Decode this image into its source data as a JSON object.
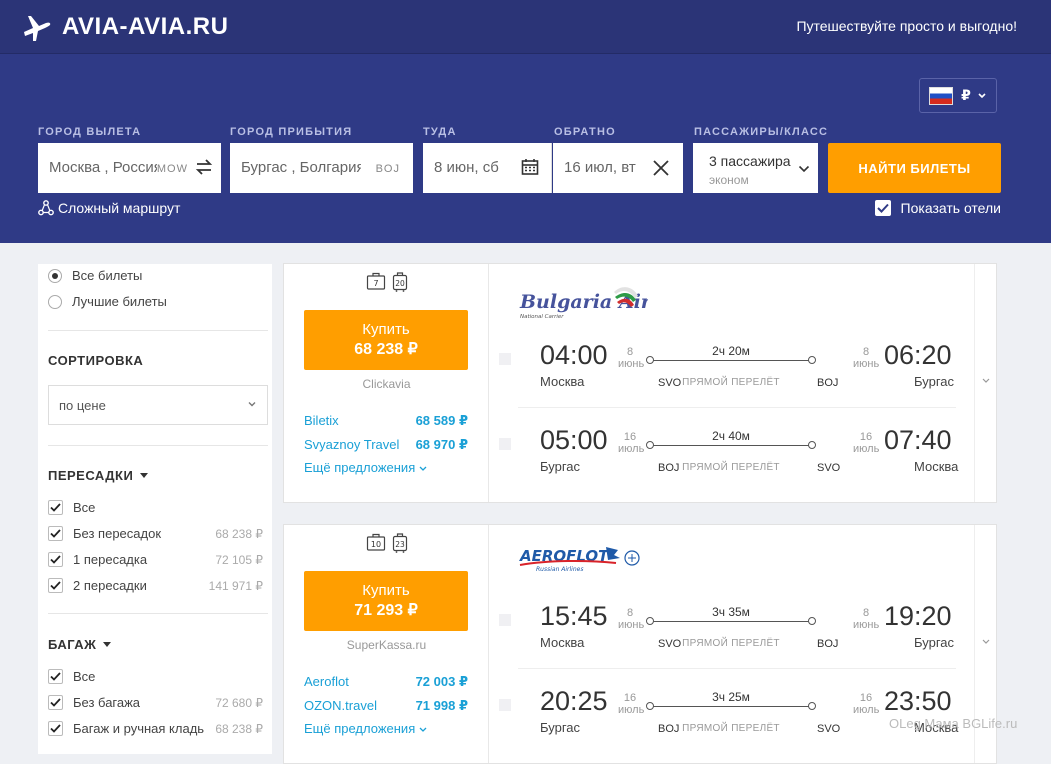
{
  "header": {
    "brand": "AVIA-AVIA.RU",
    "tagline": "Путешествуйте просто и выгодно!"
  },
  "currency": "₽",
  "search": {
    "from_label": "ГОРОД ВЫЛЕТА",
    "from_value": "Москва , Россия",
    "from_code": "MOW",
    "to_label": "ГОРОД ПРИБЫТИЯ",
    "to_value": "Бургас , Болгария",
    "to_code": "BOJ",
    "depart_label": "ТУДА",
    "depart_value": "8 июн, сб",
    "return_label": "ОБРАТНО",
    "return_value": "16 июл, вт",
    "pax_label": "ПАССАЖИРЫ/КЛАСС",
    "pax_value": "3 пассажира",
    "class_value": "эконом",
    "search_button": "НАЙТИ БИЛЕТЫ",
    "complex_route": "Сложный маршрут",
    "show_hotels": "Показать отели"
  },
  "filters": {
    "all_tickets": "Все билеты",
    "best_tickets": "Лучшие билеты",
    "sort_title": "СОРТИРОВКА",
    "sort_value": "по цене",
    "transfers_title": "ПЕРЕСАДКИ",
    "transfers": [
      {
        "label": "Все",
        "value": ""
      },
      {
        "label": "Без пересадок",
        "value": "68 238 ₽"
      },
      {
        "label": "1 пересадка",
        "value": "72 105 ₽"
      },
      {
        "label": "2 пересадки",
        "value": "141 971 ₽"
      }
    ],
    "baggage_title": "БАГАЖ",
    "baggage": [
      {
        "label": "Все",
        "value": ""
      },
      {
        "label": "Без багажа",
        "value": "72 680 ₽"
      },
      {
        "label": "Багаж и ручная кладь",
        "value": "68 238 ₽"
      }
    ]
  },
  "results": [
    {
      "airline": "Bulgaria Air",
      "airline_sub": "National Carrier",
      "bag1": "7",
      "bag2": "20",
      "buy_label": "Купить",
      "price": "68 238 ₽",
      "agent": "Clickavia",
      "offers": [
        {
          "name": "Biletix",
          "price": "68 589 ₽"
        },
        {
          "name": "Svyaznoy Travel",
          "price": "68 970 ₽"
        }
      ],
      "more": "Ещё предложения",
      "legs": [
        {
          "dep_time": "04:00",
          "dep_day": "8",
          "dep_month": "июнь",
          "dep_city": "Москва",
          "dep_ap": "SVO",
          "duration": "2ч 20м",
          "direct": "ПРЯМОЙ ПЕРЕЛЁТ",
          "arr_ap": "BOJ",
          "arr_day": "8",
          "arr_month": "июнь",
          "arr_time": "06:20",
          "arr_city": "Бургас"
        },
        {
          "dep_time": "05:00",
          "dep_day": "16",
          "dep_month": "июль",
          "dep_city": "Бургас",
          "dep_ap": "BOJ",
          "duration": "2ч 40м",
          "direct": "ПРЯМОЙ ПЕРЕЛЁТ",
          "arr_ap": "SVO",
          "arr_day": "16",
          "arr_month": "июль",
          "arr_time": "07:40",
          "arr_city": "Москва"
        }
      ]
    },
    {
      "airline": "AEROFLOT",
      "airline_sub": "Russian Airlines",
      "bag1": "10",
      "bag2": "23",
      "buy_label": "Купить",
      "price": "71 293 ₽",
      "agent": "SuperKassa.ru",
      "offers": [
        {
          "name": "Aeroflot",
          "price": "72 003 ₽"
        },
        {
          "name": "OZON.travel",
          "price": "71 998 ₽"
        }
      ],
      "more": "Ещё предложения",
      "legs": [
        {
          "dep_time": "15:45",
          "dep_day": "8",
          "dep_month": "июнь",
          "dep_city": "Москва",
          "dep_ap": "SVO",
          "duration": "3ч 35м",
          "direct": "ПРЯМОЙ ПЕРЕЛЁТ",
          "arr_ap": "BOJ",
          "arr_day": "8",
          "arr_month": "июнь",
          "arr_time": "19:20",
          "arr_city": "Бургас"
        },
        {
          "dep_time": "20:25",
          "dep_day": "16",
          "dep_month": "июль",
          "dep_city": "Бургас",
          "dep_ap": "BOJ",
          "duration": "3ч 25м",
          "direct": "ПРЯМОЙ ПЕРЕЛЁТ",
          "arr_ap": "SVO",
          "arr_day": "16",
          "arr_month": "июль",
          "arr_time": "23:50",
          "arr_city": "Москва"
        }
      ]
    }
  ],
  "watermark": "OLeg Мама BGLife.ru",
  "colors": {
    "header": "#2b3477",
    "search_bg": "#2f3a86",
    "accent": "#ff9e00",
    "link": "#1aa0d6"
  }
}
